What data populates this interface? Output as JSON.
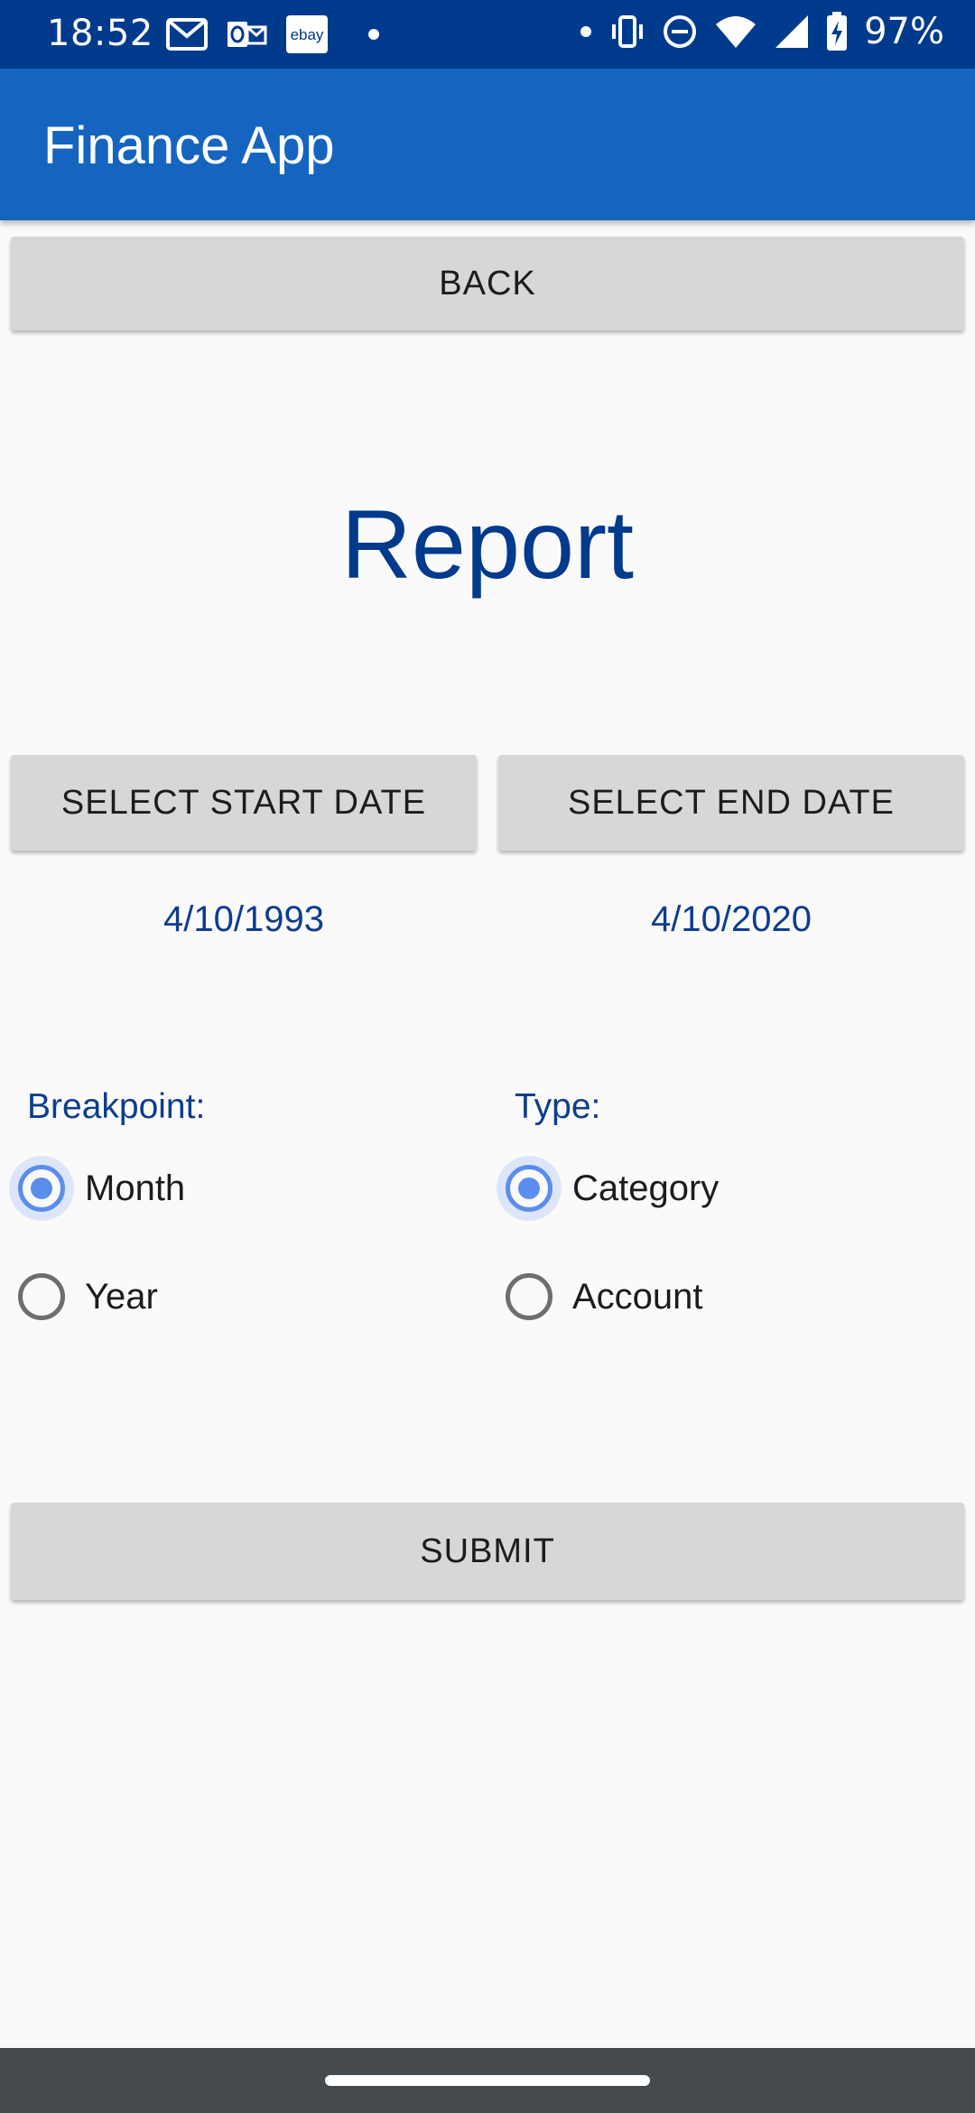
{
  "status_bar": {
    "time": "18:52",
    "battery_percent": "97%",
    "left_icons": [
      "gmail-icon",
      "outlook-icon",
      "ebay-icon",
      "dot-icon"
    ],
    "right_icons": [
      "dot-icon",
      "vibrate-icon",
      "dnd-icon",
      "wifi-icon",
      "signal-icon",
      "battery-charging-icon"
    ],
    "ebay_text": "ebay"
  },
  "app_bar": {
    "title": "Finance App"
  },
  "buttons": {
    "back": "BACK",
    "select_start_date": "SELECT START DATE",
    "select_end_date": "SELECT END DATE",
    "submit": "SUBMIT"
  },
  "report": {
    "title": "Report",
    "start_date": "4/10/1993",
    "end_date": "4/10/2020"
  },
  "breakpoint": {
    "label": "Breakpoint:",
    "options": [
      {
        "label": "Month",
        "checked": true
      },
      {
        "label": "Year",
        "checked": false
      }
    ]
  },
  "type": {
    "label": "Type:",
    "options": [
      {
        "label": "Category",
        "checked": true
      },
      {
        "label": "Account",
        "checked": false
      }
    ]
  },
  "colors": {
    "status_bar": "#003a8c",
    "app_bar": "#1565c0",
    "accent": "#5b8def",
    "title_text": "#003a8c",
    "button_bg": "#d6d7d7"
  }
}
